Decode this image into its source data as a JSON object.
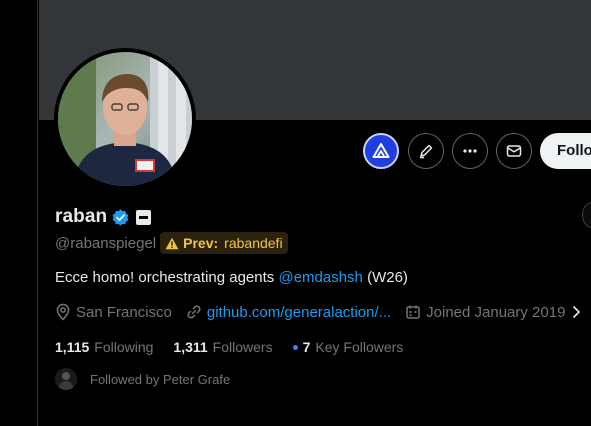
{
  "profile": {
    "display_name": "raban",
    "handle": "@rabanspiegel",
    "prev_label": "Prev:",
    "prev_handle": "rabandefi",
    "bio_text": "Ecce homo! orchestrating agents ",
    "bio_mention": "@emdashsh",
    "bio_suffix": " (W26)",
    "location": "San Francisco",
    "website": "github.com/generalaction/...",
    "joined": "Joined January 2019"
  },
  "actions": {
    "follow_label": "Follow"
  },
  "stats": {
    "following_count": "1,115",
    "following_label": "Following",
    "followers_count": "1,311",
    "followers_label": "Followers",
    "key_followers_count": "7",
    "key_followers_label": "Key Followers"
  },
  "followed_by": {
    "text": "Followed by Peter Grafe"
  },
  "icons": {
    "brand_button": "triangle-logo-icon",
    "edit": "pencil-icon",
    "more": "more-icon",
    "message": "mail-icon",
    "location": "location-pin-icon",
    "website": "link-icon",
    "joined": "calendar-icon",
    "verified": "verified-badge-icon",
    "affiliation": "affiliation-badge-icon",
    "prev_warning": "warning-icon"
  },
  "colors": {
    "background": "#000000",
    "banner": "#333639",
    "link": "#1d9bf0",
    "muted": "#71767b",
    "brand_button": "#1f3fe0",
    "prev_tag_text": "#f4c542",
    "key_followers_dot": "#3b82f6"
  }
}
